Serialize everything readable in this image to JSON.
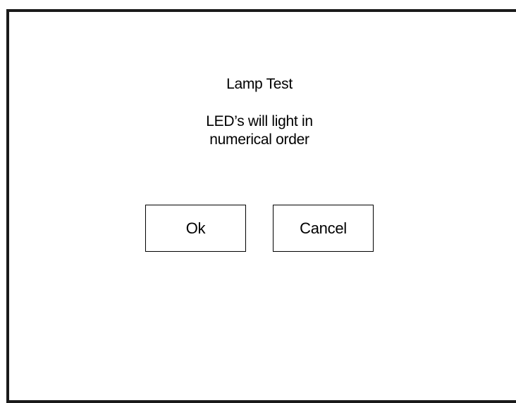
{
  "dialog": {
    "title": "Lamp Test",
    "message_line1": "LED’s will light in",
    "message_line2": "numerical order",
    "ok_label": "Ok",
    "cancel_label": "Cancel"
  },
  "colors": {
    "background": "#ffffff",
    "frame_border": "#1a1a1a",
    "text": "#000000"
  }
}
